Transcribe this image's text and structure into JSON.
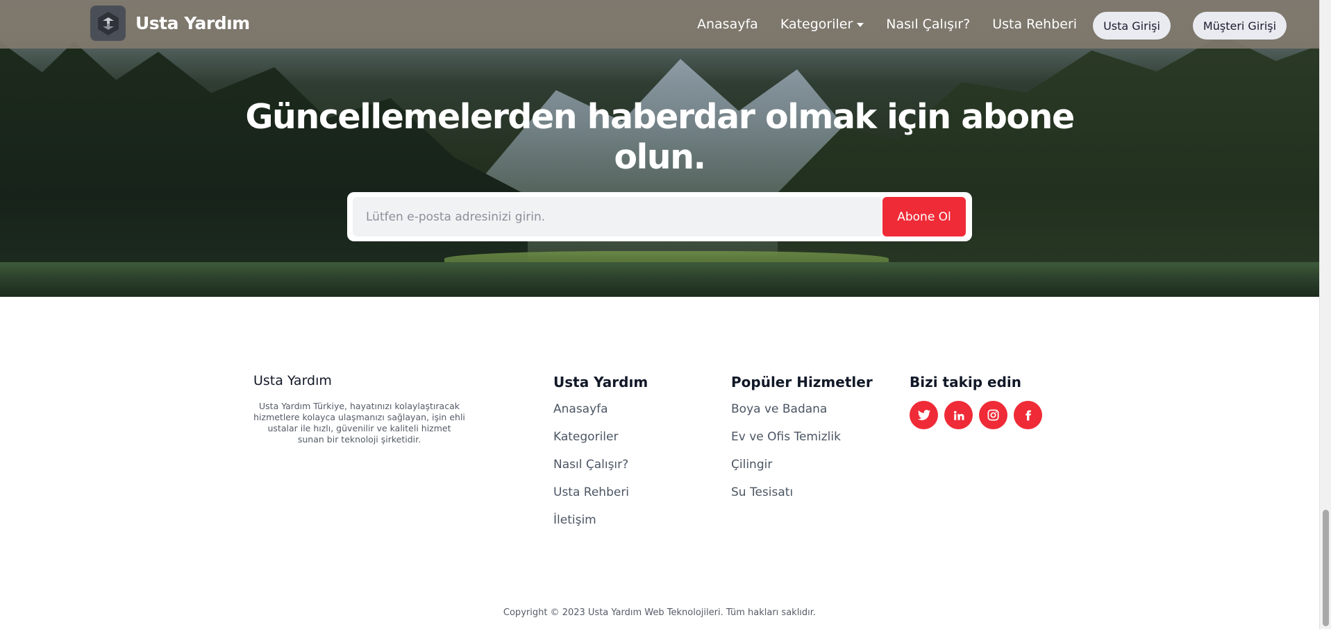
{
  "navbar": {
    "brand_name": "Usta Yardım",
    "links": [
      "Anasayfa",
      "Kategoriler",
      "Nasıl Çalışır?",
      "Usta Rehberi"
    ],
    "usta_login": "Usta Girişi",
    "musteri_login": "Müşteri Girişi"
  },
  "subscribe": {
    "title": "Güncellemelerden haberdar olmak için abone olun.",
    "placeholder": "Lütfen e-posta adresinizi girin.",
    "button": "Abone Ol"
  },
  "footer": {
    "about_title": "Usta Yardım",
    "about_text": "Usta Yardım Türkiye, hayatınızı kolaylaştıracak hizmetlere kolayca ulaşmanızı sağlayan, işin ehli ustalar ile hızlı, güvenilir ve kaliteli hizmet sunan bir teknoloji şirketidir.",
    "links_title": "Usta Yardım",
    "links": [
      "Anasayfa",
      "Kategoriler",
      "Nasıl Çalışır?",
      "Usta Rehberi",
      "İletişim"
    ],
    "services_title": "Popüler Hizmetler",
    "services": [
      "Boya ve Badana",
      "Ev ve Ofis Temizlik",
      "Çilingir",
      "Su Tesisatı"
    ],
    "social_title": "Bizi takip edin",
    "social_icons": [
      "twitter-icon",
      "linkedin-icon",
      "instagram-icon",
      "facebook-icon"
    ],
    "copyright": "Copyright © 2023 Usta Yardım Web Teknolojileri. Tüm hakları saklıdır."
  },
  "colors": {
    "accent": "#ef2b37",
    "navbar_bg": "#80786c",
    "pill_bg": "#e9ebf0"
  }
}
